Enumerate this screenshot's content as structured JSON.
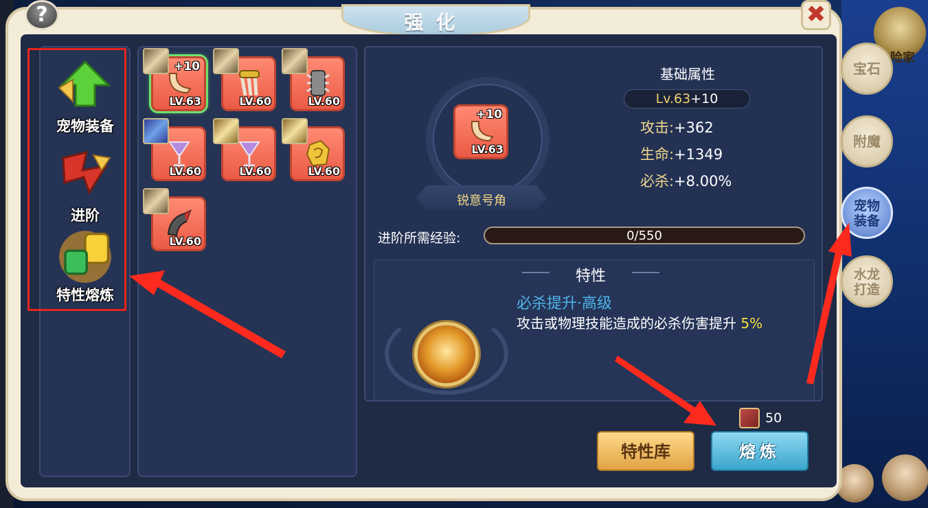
{
  "window": {
    "title": "强化",
    "help_label": "?",
    "close_label": "✖",
    "colors": {
      "panel": "#f3ecd9",
      "inner": "#1f2a45",
      "highlight": "#e8251c",
      "accent_gold": "#f0d070"
    }
  },
  "background": {
    "explorer_label": "险家"
  },
  "categories": [
    {
      "label": "宠物装备",
      "icon": "green-arrow-up-icon"
    },
    {
      "label": "进阶",
      "icon": "red-arrow-advance-icon"
    },
    {
      "label": "特性熔炼",
      "icon": "gem-smelt-icon"
    }
  ],
  "equipment": [
    {
      "level": "LV.63",
      "plus": "+10",
      "icon": "horn-icon",
      "selected": true
    },
    {
      "level": "LV.60",
      "plus": "",
      "icon": "claw-icon",
      "selected": false
    },
    {
      "level": "LV.60",
      "plus": "",
      "icon": "spiked-shield-icon",
      "selected": false
    },
    {
      "level": "LV.60",
      "plus": "",
      "icon": "goblet-icon",
      "selected": false
    },
    {
      "level": "LV.60",
      "plus": "",
      "icon": "goblet-icon",
      "selected": false
    },
    {
      "level": "LV.60",
      "plus": "",
      "icon": "gold-rune-icon",
      "selected": false
    },
    {
      "level": "LV.60",
      "plus": "",
      "icon": "red-horn-icon",
      "selected": false
    }
  ],
  "detail": {
    "item_plus": "+10",
    "item_level": "LV.63",
    "item_name": "锐意号角",
    "attr_title": "基础属性",
    "lv_main": "Lv.63",
    "lv_plus": "+10",
    "attrs": [
      {
        "key": "攻击:",
        "value": "+362"
      },
      {
        "key": "生命:",
        "value": "+1349"
      },
      {
        "key": "必杀:",
        "value": "+8.00%"
      }
    ],
    "exp_label": "进阶所需经验:",
    "exp_text": "0/550",
    "exp_progress": 0,
    "trait_title": "特性",
    "trait_name": "必杀提升·高级",
    "trait_desc": "攻击或物理技能造成的必杀伤害提升",
    "trait_pct": "5%",
    "cost_value": "50",
    "cost_icon": "book-icon",
    "btn_library": "特性库",
    "btn_smelt": "熔炼"
  },
  "side_tabs": [
    {
      "label": "宝石",
      "active": false
    },
    {
      "label": "附魔",
      "active": false
    },
    {
      "label": "宠物装备",
      "active": true
    },
    {
      "label": "水龙打造",
      "active": false
    }
  ]
}
